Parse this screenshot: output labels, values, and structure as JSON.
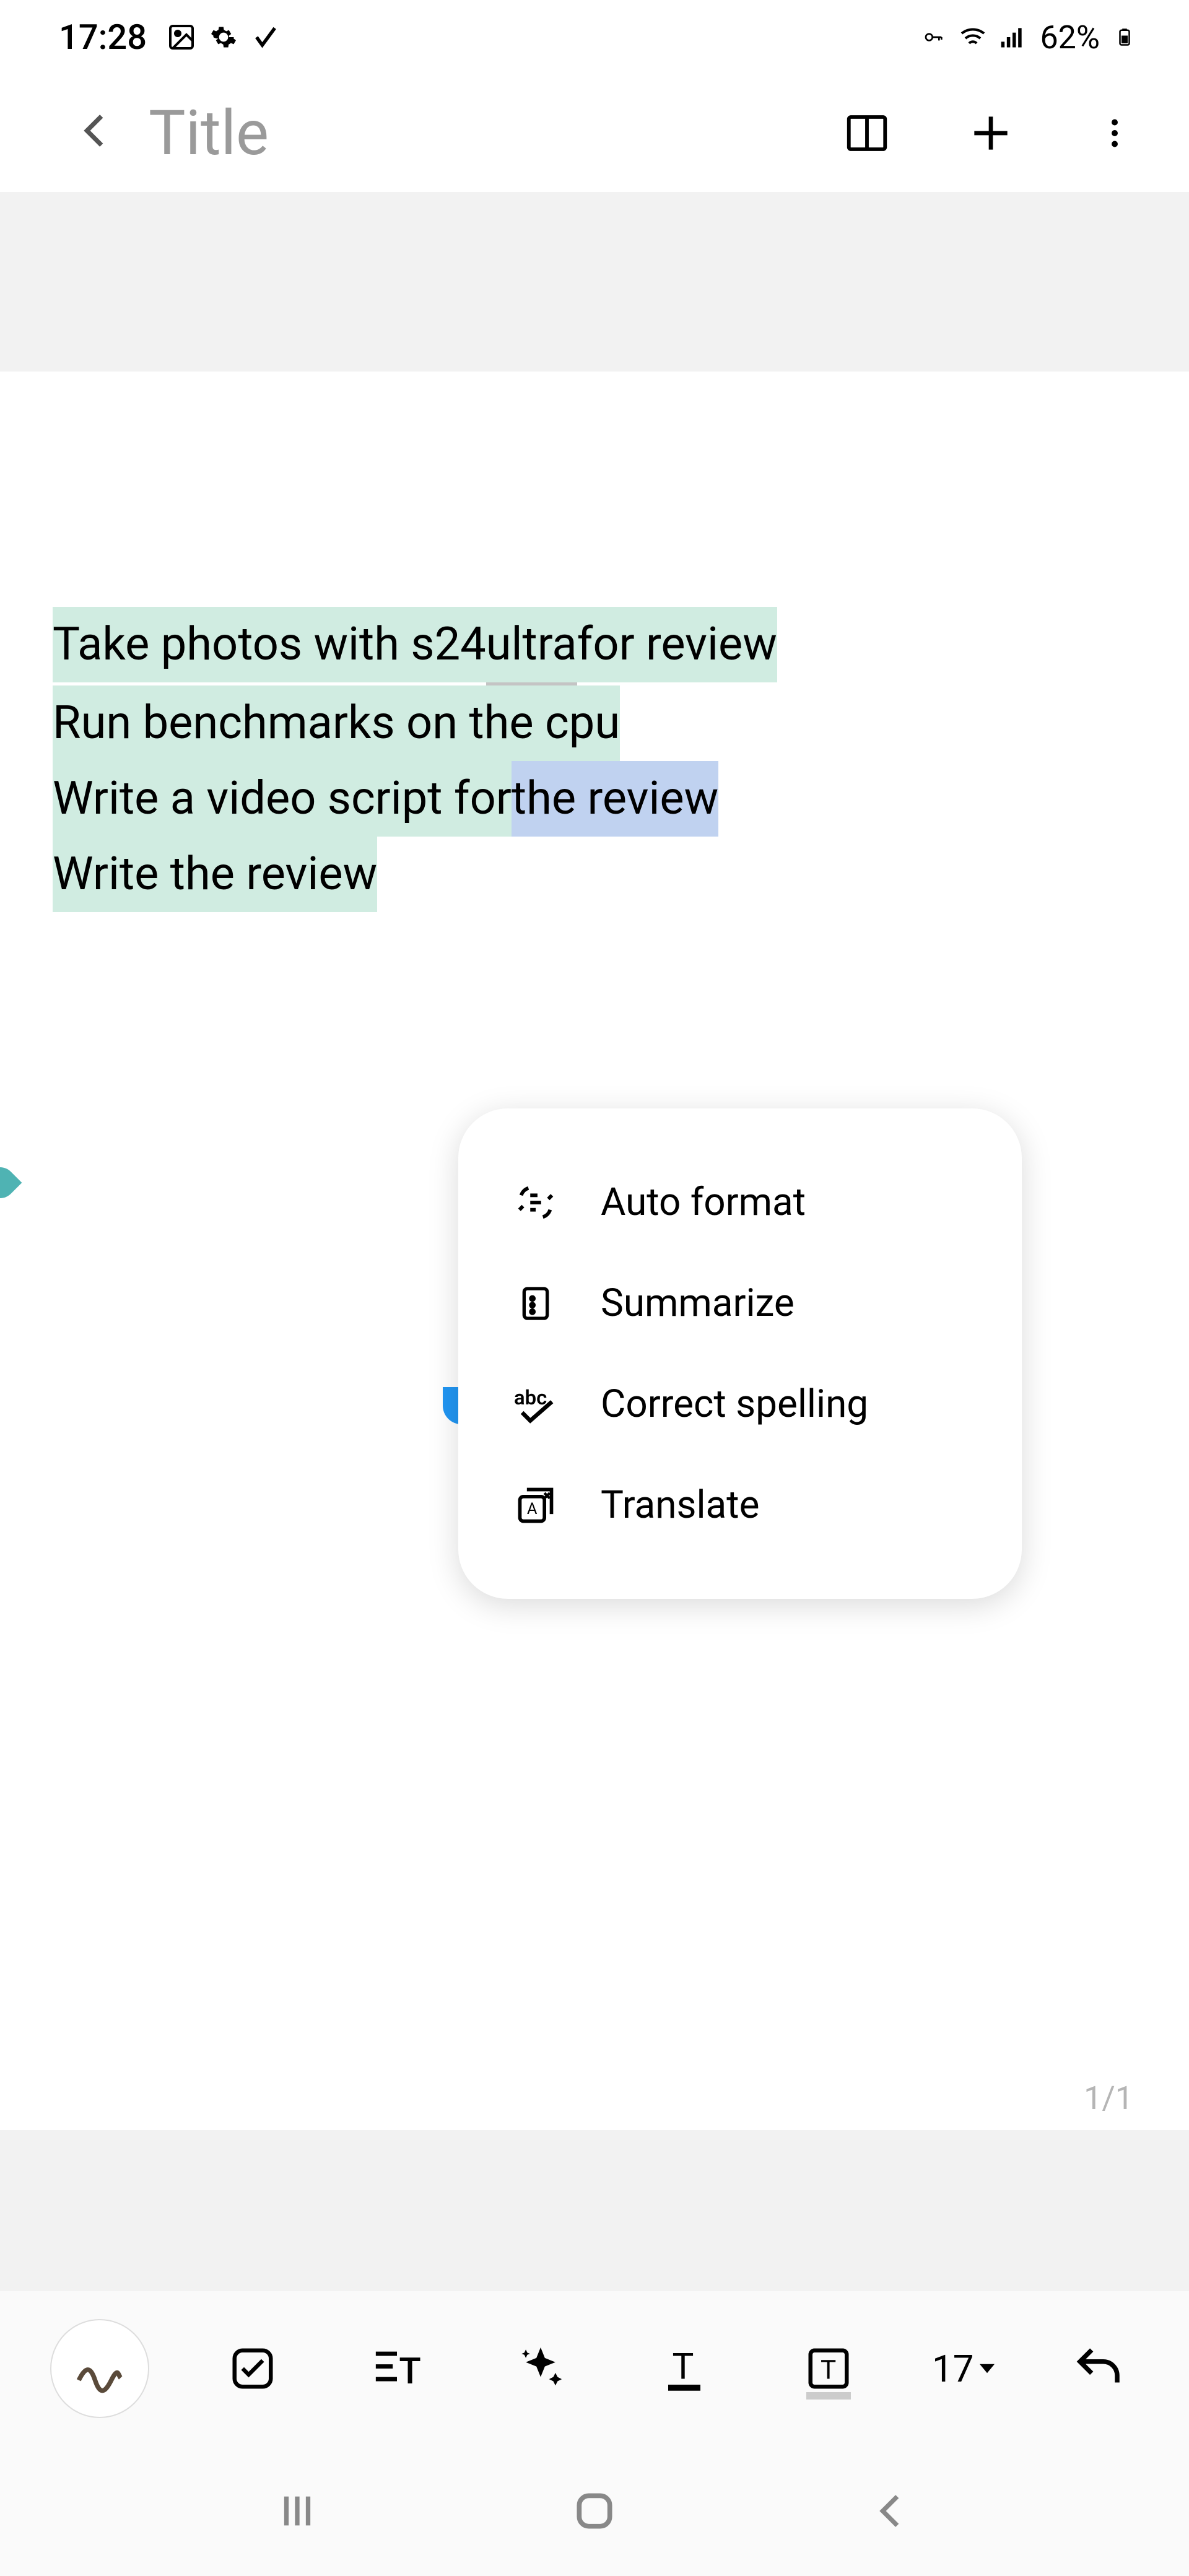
{
  "status": {
    "time": "17:28",
    "battery": "62%"
  },
  "appbar": {
    "title_placeholder": "Title"
  },
  "note": {
    "line1": "Take photos with s24 ultra for review",
    "line1_pre": "Take photos with s24 ",
    "line1_under": "ultra",
    "line1_post": " for review",
    "line2": "Run benchmarks on the cpu",
    "line3_pre": "Write a video script for ",
    "line3_post": "the review",
    "line4": "Write the review"
  },
  "popup": {
    "auto_format": "Auto format",
    "summarize": "Summarize",
    "correct_spelling": "Correct spelling",
    "translate": "Translate"
  },
  "page_indicator": "1/1",
  "toolbar": {
    "font_size": "17"
  }
}
